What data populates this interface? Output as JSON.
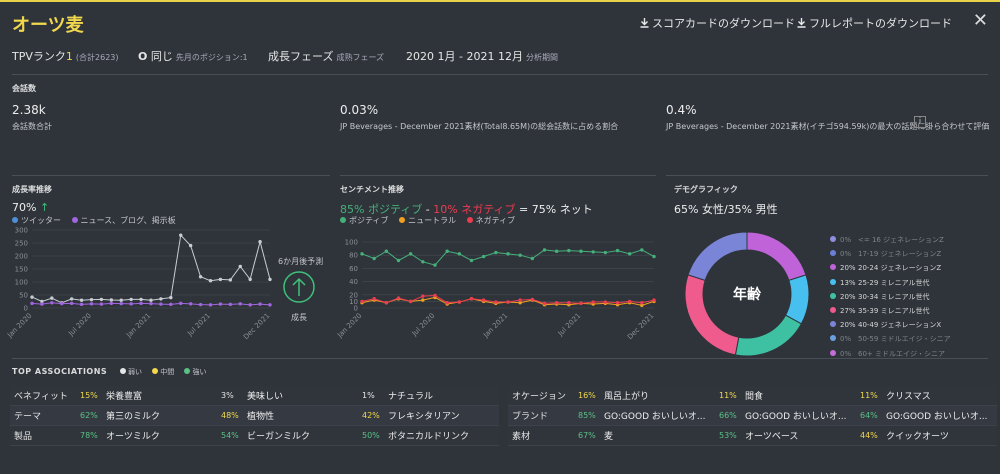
{
  "header": {
    "title": "オーツ麦",
    "download_scorecard": "スコアカードのダウンロード",
    "download_report": "フルレポートのダウンロード"
  },
  "summary": {
    "tpv_label": "TPVランク",
    "tpv_rank": "1",
    "tpv_total": "(合計2623)",
    "same_icon_text": "O",
    "same_label": "同じ",
    "same_sub": "先月のポジション:1",
    "phase_label": "成長フェーズ",
    "phase_sub": "成熟フェーズ",
    "period": "2020 1月 - 2021 12月",
    "period_sub": "分析期間"
  },
  "mentions": {
    "section_title": "会話数",
    "stats": [
      {
        "value": "2.38k",
        "label": "会話数合計"
      },
      {
        "value": "0.03%",
        "label": "JP Beverages - December 2021素材(Total8.65M)の総会話数に占める割合"
      },
      {
        "value": "0.4%",
        "label": "JP Beverages - December 2021素材(イチゴ594.59k)の最大の話題に掛ら合わせて評価"
      }
    ],
    "info_icon": "i"
  },
  "growth": {
    "title": "成長率推移",
    "headline": "70%",
    "legend": [
      "ツイッター",
      "ニュース、ブログ、掲示板"
    ],
    "forecast_label": "6か月後予測",
    "forecast_value": "成長"
  },
  "sentiment": {
    "title": "センチメント推移",
    "pos_text": "85% ポジティブ",
    "sep1": " - ",
    "neg_text": "10% ネガティブ",
    "net_text": " = 75% ネット",
    "legend": [
      "ポジティブ",
      "ニュートラル",
      "ネガティブ"
    ]
  },
  "demographics": {
    "title": "デモグラフィック",
    "headline": "65% 女性/35% 男性",
    "center_label": "年齢",
    "legend": [
      {
        "pct": "0%",
        "label": "<= 16 ジェネレーションZ",
        "color": "#8f8fe0",
        "faded": true
      },
      {
        "pct": "0%",
        "label": "17-19 ジェネレーションZ",
        "color": "#6c7fd8",
        "faded": true
      },
      {
        "pct": "20%",
        "label": "20-24 ジェネレーションZ",
        "color": "#c063d8",
        "faded": false
      },
      {
        "pct": "13%",
        "label": "25-29 ミレニアル世代",
        "color": "#48c0ef",
        "faded": false
      },
      {
        "pct": "20%",
        "label": "30-34 ミレニアル世代",
        "color": "#3ec1a3",
        "faded": false
      },
      {
        "pct": "27%",
        "label": "35-39 ミレニアル世代",
        "color": "#ef5b8d",
        "faded": false
      },
      {
        "pct": "20%",
        "label": "40-49 ジェネレーションX",
        "color": "#7b85d8",
        "faded": false
      },
      {
        "pct": "0%",
        "label": "50-59 ミドルエイジ・シニア",
        "color": "#6aa0e0",
        "faded": true
      },
      {
        "pct": "0%",
        "label": "60+ ミドルエイジ・シニア",
        "color": "#c46cd8",
        "faded": true
      }
    ]
  },
  "associations": {
    "title": "TOP ASSOCIATIONS",
    "legend": [
      "弱い",
      "中間",
      "強い"
    ],
    "left": [
      {
        "cat": "ベネフィット",
        "items": [
          {
            "p": "15%",
            "n": "栄養豊富",
            "c": "y"
          },
          {
            "p": "3%",
            "n": "美味しい",
            "c": "w"
          },
          {
            "p": "1%",
            "n": "ナチュラル",
            "c": "w"
          }
        ]
      },
      {
        "cat": "テーマ",
        "items": [
          {
            "p": "62%",
            "n": "第三のミルク",
            "c": "g"
          },
          {
            "p": "48%",
            "n": "植物性",
            "c": "y"
          },
          {
            "p": "42%",
            "n": "フレキシタリアン",
            "c": "y"
          }
        ]
      },
      {
        "cat": "製品",
        "items": [
          {
            "p": "78%",
            "n": "オーツミルク",
            "c": "g"
          },
          {
            "p": "54%",
            "n": "ビーガンミルク",
            "c": "g"
          },
          {
            "p": "50%",
            "n": "ボタニカルドリンク",
            "c": "g"
          }
        ]
      }
    ],
    "right": [
      {
        "cat": "オケージョン",
        "items": [
          {
            "p": "16%",
            "n": "風呂上がり",
            "c": "y"
          },
          {
            "p": "11%",
            "n": "間食",
            "c": "y"
          },
          {
            "p": "11%",
            "n": "クリスマス",
            "c": "y"
          }
        ]
      },
      {
        "cat": "ブランド",
        "items": [
          {
            "p": "85%",
            "n": "GO:GOOD おいしいオ...",
            "c": "g"
          },
          {
            "p": "66%",
            "n": "GO:GOOD おいしいオ...",
            "c": "g"
          },
          {
            "p": "64%",
            "n": "GO:GOOD おいしいオ...",
            "c": "g"
          }
        ]
      },
      {
        "cat": "素材",
        "items": [
          {
            "p": "67%",
            "n": "麦",
            "c": "g"
          },
          {
            "p": "53%",
            "n": "オーツベース",
            "c": "g"
          },
          {
            "p": "44%",
            "n": "クイックオーツ",
            "c": "y"
          }
        ]
      }
    ]
  },
  "chart_data": [
    {
      "type": "line",
      "title": "成長率推移",
      "x_ticks": [
        "Jan 2020",
        "Jul 2020",
        "Jan 2021",
        "Jul 2021",
        "Dec 2021"
      ],
      "ylim": [
        0,
        300
      ],
      "y_ticks": [
        0,
        50,
        100,
        150,
        200,
        250,
        300
      ],
      "grid": true,
      "series": [
        {
          "name": "ツイッター",
          "color": "#c8cdd3",
          "values": [
            42,
            25,
            38,
            20,
            35,
            30,
            32,
            33,
            31,
            30,
            33,
            33,
            30,
            35,
            40,
            280,
            240,
            120,
            105,
            110,
            108,
            160,
            110,
            255,
            110
          ]
        },
        {
          "name": "ニュース、ブログ、掲示板",
          "color": "#a066e0",
          "values": [
            18,
            15,
            20,
            17,
            18,
            14,
            16,
            15,
            18,
            17,
            16,
            18,
            17,
            15,
            14,
            18,
            16,
            13,
            12,
            15,
            14,
            16,
            12,
            15,
            12
          ]
        }
      ]
    },
    {
      "type": "line",
      "title": "センチメント推移",
      "x_ticks": [
        "Jan 2020",
        "Jul 2020",
        "Jan 2021",
        "Jul 2021",
        "Dec 2021"
      ],
      "ylim": [
        0,
        100
      ],
      "y_ticks": [
        0,
        10,
        20,
        40,
        60,
        80,
        100
      ],
      "grid": true,
      "series": [
        {
          "name": "ポジティブ",
          "color": "#46b07a",
          "values": [
            82,
            75,
            86,
            72,
            82,
            70,
            65,
            86,
            82,
            72,
            78,
            84,
            82,
            80,
            75,
            88,
            86,
            87,
            86,
            85,
            84,
            87,
            82,
            88,
            78
          ]
        },
        {
          "name": "ニュートラル",
          "color": "#f0a020",
          "values": [
            8,
            12,
            8,
            14,
            10,
            12,
            16,
            6,
            9,
            14,
            10,
            7,
            9,
            8,
            12,
            5,
            6,
            5,
            7,
            6,
            7,
            5,
            8,
            4,
            10
          ]
        },
        {
          "name": "ネガティブ",
          "color": "#ec3c50",
          "values": [
            10,
            14,
            8,
            15,
            10,
            18,
            19,
            8,
            9,
            14,
            12,
            9,
            9,
            12,
            13,
            7,
            8,
            8,
            7,
            9,
            9,
            8,
            10,
            8,
            12
          ]
        }
      ]
    },
    {
      "type": "pie",
      "title": "年齢",
      "categories": [
        "20-24",
        "25-29",
        "30-34",
        "35-39",
        "40-49"
      ],
      "values": [
        20,
        13,
        20,
        27,
        20
      ],
      "colors": [
        "#c063d8",
        "#48c0ef",
        "#3ec1a3",
        "#ef5b8d",
        "#7b85d8"
      ]
    }
  ]
}
